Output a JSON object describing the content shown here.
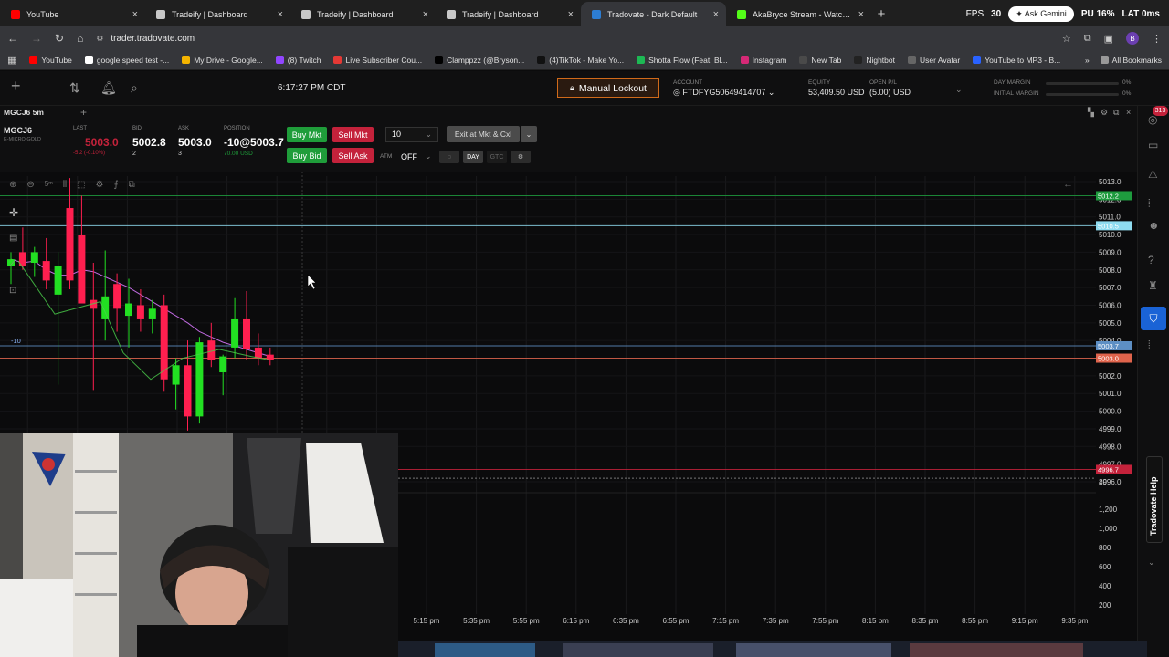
{
  "browser": {
    "tabs": [
      {
        "title": "YouTube",
        "color": "#ff0000",
        "active": false
      },
      {
        "title": "Tradeify | Dashboard",
        "color": "#c8c8c8",
        "active": false
      },
      {
        "title": "Tradeify | Dashboard",
        "color": "#c8c8c8",
        "active": false
      },
      {
        "title": "Tradeify | Dashboard",
        "color": "#c8c8c8",
        "active": false
      },
      {
        "title": "Tradovate - Dark Default",
        "color": "#2d7dd2",
        "active": true
      },
      {
        "title": "AkaBryce Stream - Watch Live c",
        "color": "#53fc18",
        "active": false
      }
    ],
    "new_tab": "+",
    "fps_label": "FPS",
    "fps_value": "30",
    "ask_gemini": "Ask Gemini",
    "cpu_label": "PU 16%",
    "lat_label": "LAT 0ms",
    "url": "trader.tradovate.com",
    "all_bookmarks": "All Bookmarks",
    "bookmarks": [
      {
        "label": "YouTube",
        "color": "#ff0000"
      },
      {
        "label": "google speed test -...",
        "color": "#ffffff"
      },
      {
        "label": "My Drive - Google...",
        "color": "#f4b400"
      },
      {
        "label": "(8) Twitch",
        "color": "#9146ff"
      },
      {
        "label": "Live Subscriber Cou...",
        "color": "#e53935"
      },
      {
        "label": "Clamppzz (@Bryson...",
        "color": "#000000"
      },
      {
        "label": "(4)TikTok - Make Yo...",
        "color": "#111111"
      },
      {
        "label": "Shotta Flow (Feat. Bl...",
        "color": "#1db954"
      },
      {
        "label": "Instagram",
        "color": "#d62976"
      },
      {
        "label": "New Tab",
        "color": "#4a4a4a"
      },
      {
        "label": "Nightbot",
        "color": "#222222"
      },
      {
        "label": "User Avatar",
        "color": "#666666"
      },
      {
        "label": "YouTube to MP3 - B...",
        "color": "#2962ff"
      }
    ]
  },
  "header": {
    "clock": "6:17:27 PM CDT",
    "manual_lockout": "Manual Lockout",
    "account_label": "ACCOUNT",
    "account_value": "FTDFYG50649414707",
    "equity_label": "EQUITY",
    "equity_value": "53,409.50 USD",
    "open_pl_label": "OPEN P/L",
    "open_pl_value": "(5.00) USD",
    "day_margin_label": "DAY MARGIN",
    "initial_margin_label": "INITIAL MARGIN",
    "day_margin_pct": "0%",
    "initial_margin_pct": "0%"
  },
  "symbar": {
    "symbol": "MGCJ6 5m",
    "notif_count": "313"
  },
  "quote": {
    "symbol": "MGCJ6",
    "subtitle": "E-MICRO GOLD",
    "last_label": "LAST",
    "last_value": "5003.0",
    "last_change": "-5.2 (-0.10%)",
    "bid_label": "BID",
    "bid_value": "5002.8",
    "bid_size": "2",
    "ask_label": "ASK",
    "ask_value": "5003.0",
    "ask_size": "3",
    "position_label": "POSITION",
    "position_value": "-10@5003.7",
    "position_pl": "70.00 USD",
    "buy_mkt": "Buy Mkt",
    "sell_mkt": "Sell Mkt",
    "buy_bid": "Buy Bid",
    "sell_ask": "Sell Ask",
    "quantity": "10",
    "exit_label": "Exit at Mkt & Cxl",
    "atm_label": "ATM",
    "atm_value": "OFF",
    "day_label": "DAY",
    "gtc_label": "GTC"
  },
  "chart": {
    "price_ticks": [
      "5013.0",
      "5012.0",
      "5011.0",
      "5010.0",
      "5009.0",
      "5008.0",
      "5007.0",
      "5006.0",
      "5005.0",
      "5004.0",
      "5003.0",
      "5002.0",
      "5001.0",
      "5000.0",
      "4999.0",
      "4998.0",
      "4997.0",
      "4996.0"
    ],
    "tags": [
      {
        "price": "5012.2",
        "color": "#1e9b3e"
      },
      {
        "price": "5010.5",
        "color": "#8fdcf0"
      },
      {
        "price": "5003.7",
        "color": "#5d8fc4"
      },
      {
        "price": "5003.0",
        "color": "#e0644c"
      },
      {
        "price": "4996.7",
        "color": "#c4223b"
      }
    ],
    "position_marker": "-10",
    "volume_ticks": [
      "20",
      "1,200",
      "1,000",
      "800",
      "600",
      "400",
      "200"
    ],
    "time_ticks": [
      "5:15 pm",
      "5:35 pm",
      "5:55 pm",
      "6:15 pm",
      "6:35 pm",
      "6:55 pm",
      "7:15 pm",
      "7:35 pm",
      "7:55 pm",
      "8:15 pm",
      "8:35 pm",
      "8:55 pm",
      "9:15 pm",
      "9:35 pm"
    ],
    "help": "Tradovate Help",
    "candles": [
      {
        "o": 5008.2,
        "h": 5009.0,
        "l": 5007.2,
        "c": 5008.6
      },
      {
        "o": 5009.0,
        "h": 5010.4,
        "l": 5008.0,
        "c": 5008.2
      },
      {
        "o": 5008.4,
        "h": 5009.3,
        "l": 5007.6,
        "c": 5009.0
      },
      {
        "o": 5008.5,
        "h": 5009.8,
        "l": 5006.9,
        "c": 5007.4
      },
      {
        "o": 5006.6,
        "h": 5009.0,
        "l": 5001.5,
        "c": 5008.2
      },
      {
        "o": 5011.5,
        "h": 5013.2,
        "l": 5006.9,
        "c": 5007.4
      },
      {
        "o": 5010.0,
        "h": 5012.2,
        "l": 5007.1,
        "c": 5006.1
      },
      {
        "o": 5006.3,
        "h": 5008.4,
        "l": 5001.2,
        "c": 5005.8
      },
      {
        "o": 5005.2,
        "h": 5009.1,
        "l": 5004.0,
        "c": 5006.5
      },
      {
        "o": 5007.2,
        "h": 5007.8,
        "l": 5004.5,
        "c": 5005.8
      },
      {
        "o": 5005.4,
        "h": 5007.5,
        "l": 5003.6,
        "c": 5006.1
      },
      {
        "o": 5006.0,
        "h": 5006.9,
        "l": 5004.5,
        "c": 5005.2
      },
      {
        "o": 5005.2,
        "h": 5006.3,
        "l": 5004.4,
        "c": 5005.8
      },
      {
        "o": 5006.0,
        "h": 5006.6,
        "l": 5001.1,
        "c": 5001.8
      },
      {
        "o": 5001.5,
        "h": 5003.0,
        "l": 5000.1,
        "c": 5002.6
      },
      {
        "o": 5002.6,
        "h": 5004.0,
        "l": 4998.9,
        "c": 4999.7
      },
      {
        "o": 4999.7,
        "h": 5004.2,
        "l": 4999.3,
        "c": 5003.9
      },
      {
        "o": 5004.0,
        "h": 5005.0,
        "l": 5002.5,
        "c": 5002.9
      },
      {
        "o": 5002.2,
        "h": 5003.2,
        "l": 5000.9,
        "c": 5003.1
      },
      {
        "o": 5003.6,
        "h": 5006.4,
        "l": 5003.0,
        "c": 5005.2
      },
      {
        "o": 5005.2,
        "h": 5006.8,
        "l": 5002.9,
        "c": 5003.5
      },
      {
        "o": 5003.6,
        "h": 5004.4,
        "l": 5002.6,
        "c": 5003.0
      },
      {
        "o": 5003.2,
        "h": 5003.6,
        "l": 5002.6,
        "c": 5002.9
      }
    ],
    "ma": [
      5008.6,
      5008.4,
      5008.5,
      5008.0,
      5007.7,
      5007.7,
      5008.0,
      5007.9,
      5007.6,
      5007.3,
      5007.0,
      5006.6,
      5006.2,
      5005.8,
      5005.4,
      5005.0,
      5004.5,
      5004.2,
      5003.9,
      5003.7,
      5003.5,
      5003.3,
      5003.1
    ]
  }
}
